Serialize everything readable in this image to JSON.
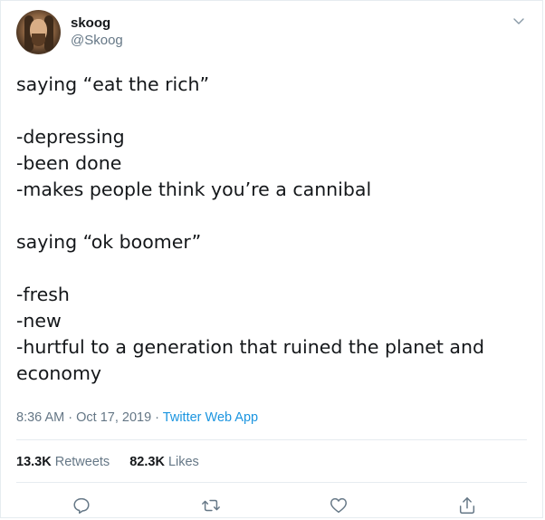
{
  "tweet": {
    "display_name": "skoog",
    "handle": "@Skoog",
    "lines": [
      "saying “eat the rich”",
      "",
      "-depressing",
      "-been done",
      "-makes people think you’re a cannibal",
      "",
      "saying “ok boomer”",
      "",
      "-fresh",
      "-new",
      "-hurtful to a generation that ruined the planet and",
      "economy"
    ],
    "time": "8:36 AM",
    "separator": "·",
    "date": "Oct 17, 2019",
    "source": "Twitter Web App",
    "retweets_count": "13.3K",
    "retweets_label": "Retweets",
    "likes_count": "82.3K",
    "likes_label": "Likes"
  },
  "icons": {
    "menu": "chevron-down-icon",
    "reply": "reply-icon",
    "retweet": "retweet-icon",
    "like": "heart-icon",
    "share": "share-icon"
  },
  "colors": {
    "text": "#14171a",
    "secondary": "#657786",
    "link": "#1b95e0",
    "border": "#e6ecf0"
  }
}
